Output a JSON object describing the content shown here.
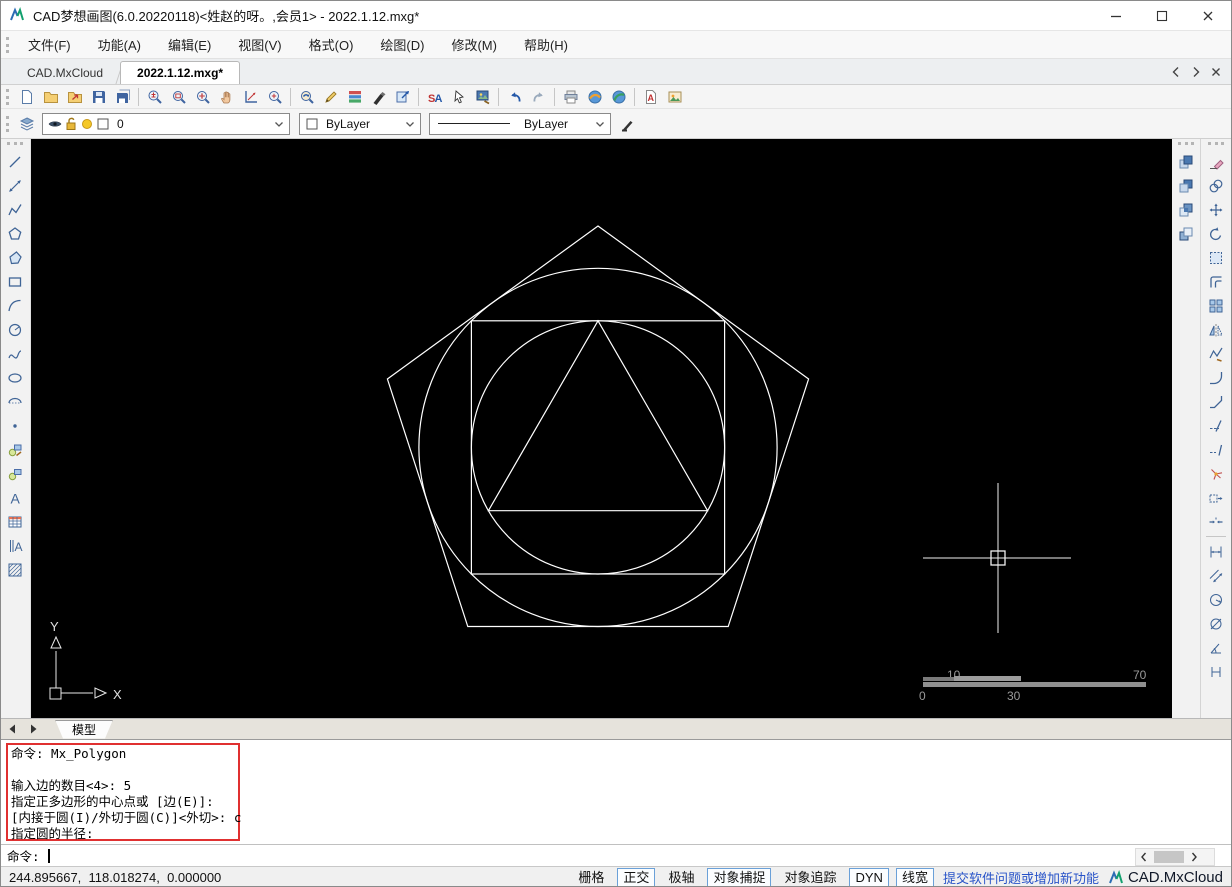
{
  "window": {
    "title": "CAD梦想画图(6.0.20220118)<姓赵的呀。,会员1> - 2022.1.12.mxg*"
  },
  "menu": {
    "items": [
      {
        "name": "menu-file",
        "label": "文件(F)"
      },
      {
        "name": "menu-function",
        "label": "功能(A)"
      },
      {
        "name": "menu-edit",
        "label": "编辑(E)"
      },
      {
        "name": "menu-view",
        "label": "视图(V)"
      },
      {
        "name": "menu-format",
        "label": "格式(O)"
      },
      {
        "name": "menu-draw",
        "label": "绘图(D)"
      },
      {
        "name": "menu-modify",
        "label": "修改(M)"
      },
      {
        "name": "menu-help",
        "label": "帮助(H)"
      }
    ]
  },
  "tabs": {
    "items": [
      {
        "name": "tab-cad-mxcloud",
        "label": "CAD.MxCloud",
        "active": false
      },
      {
        "name": "tab-document",
        "label": "2022.1.12.mxg*",
        "active": true
      }
    ]
  },
  "toolbar_main": {
    "groups": [
      [
        "new-file-icon",
        "open-folder-icon",
        "open-cloud-icon",
        "save-icon",
        "save-as-icon"
      ],
      [
        "zoom-inout-icon",
        "zoom-window-icon",
        "zoom-extents-icon",
        "pan-icon",
        "angle-icon",
        "zoom-plus-icon"
      ],
      [
        "view-back-icon",
        "pen-icon",
        "layers-color-icon",
        "brush-icon",
        "export-icon"
      ],
      [
        "text-style-icon",
        "select-hand-icon",
        "image-save-icon"
      ],
      [
        "undo-icon",
        "redo-icon"
      ],
      [
        "print-icon",
        "web-orange-icon",
        "web-green-icon"
      ],
      [
        "pdf-icon",
        "image-file-icon"
      ]
    ]
  },
  "format_bar": {
    "layer_value": "0",
    "color_value": "ByLayer",
    "linetype_value": "ByLayer"
  },
  "left_toolbar": {
    "items": [
      "line-icon",
      "xline-icon",
      "polyline-icon",
      "polygon-icon",
      "polygon2-icon",
      "rectangle-icon",
      "arc-icon",
      "circle-icon",
      "spline-icon",
      "ellipse-icon",
      "ellipse-arc-icon",
      "point-icon",
      "block-insert-icon",
      "block-make-icon",
      "text-icon",
      "table-icon",
      "vertical-text-icon",
      "hatch-icon"
    ]
  },
  "right_toolbar": {
    "inner": [
      "draw-order-front-icon",
      "draw-order-back-icon",
      "draw-order-above-icon",
      "draw-order-below-icon"
    ],
    "outer_groups": [
      [
        "erase-icon",
        "copy-icon",
        "move-icon",
        "rotate-icon",
        "select-rect-icon",
        "offset-icon",
        "array-icon",
        "mirror-icon",
        "pedit-icon",
        "fillet-icon",
        "chamfer-icon",
        "trim-icon",
        "extend-icon",
        "explode-icon",
        "stretch-icon",
        "break-icon"
      ],
      [
        "dim-linear-icon",
        "dim-aligned-icon",
        "dim-radius-icon",
        "dim-diameter-icon",
        "dim-angular-icon",
        "dim-continue-icon"
      ]
    ]
  },
  "canvas": {
    "ruler": {
      "top_left": "10",
      "top_right": "70",
      "bottom_left": "0",
      "bottom_mid": "30"
    },
    "ucs": {
      "x_label": "X",
      "y_label": "Y"
    }
  },
  "model_bar": {
    "tab_label": "模型"
  },
  "command": {
    "history": [
      "命令: Mx_Polygon",
      "",
      "输入边的数目<4>: 5",
      "指定正多边形的中心点或 [边(E)]:",
      "[内接于圆(I)/外切于圆(C)]<外切>: c",
      "指定圆的半径:"
    ],
    "prompt": "命令:"
  },
  "status_bar": {
    "coordinates": "244.895667,  118.018274,  0.000000",
    "toggles": [
      {
        "name": "toggle-grid",
        "label": "栅格",
        "active": false
      },
      {
        "name": "toggle-ortho",
        "label": "正交",
        "active": true
      },
      {
        "name": "toggle-polar",
        "label": "极轴",
        "active": false
      },
      {
        "name": "toggle-osnap",
        "label": "对象捕捉",
        "active": true
      },
      {
        "name": "toggle-otrack",
        "label": "对象追踪",
        "active": false
      },
      {
        "name": "toggle-dyn",
        "label": "DYN",
        "active": true
      },
      {
        "name": "toggle-lineweight",
        "label": "线宽",
        "active": true
      }
    ],
    "link": "提交软件问题或增加新功能",
    "brand": "CAD.MxCloud"
  },
  "colors": {
    "canvas_bg": "#000000",
    "highlight_red": "#e03030",
    "toggle_border": "#6aa0d8",
    "link_blue": "#2853c8",
    "brand_green": "#12a06e",
    "brand_blue": "#2c6cb4"
  }
}
